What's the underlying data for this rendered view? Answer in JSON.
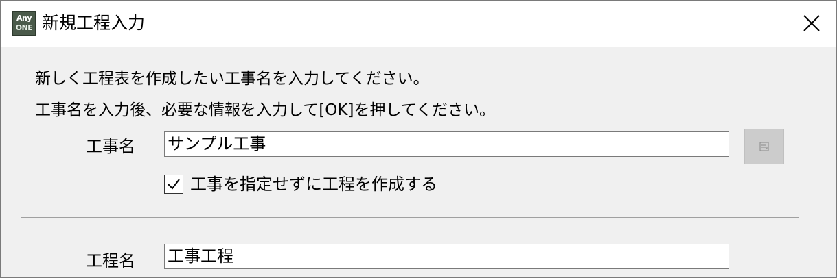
{
  "window": {
    "title": "新規工程入力",
    "app_icon": {
      "line1": "Any",
      "line2": "ONE"
    }
  },
  "instructions": {
    "line1": "新しく工程表を作成したい工事名を入力してください。",
    "line2": "工事名を入力後、必要な情報を入力して[OK]を押してください。"
  },
  "construction": {
    "label": "工事名",
    "value": "サンプル工事",
    "browse_icon": "select-list-icon"
  },
  "no_construction_checkbox": {
    "checked": true,
    "label": "工事を指定せずに工程を作成する"
  },
  "process": {
    "label": "工程名",
    "value": "工事工程"
  },
  "icons": {
    "close": "close-icon",
    "check": "check-icon"
  },
  "colors": {
    "titlebar": "#ffffff",
    "client_background": "#f0f0f0",
    "disabled_button": "#cccccc",
    "input_border": "#7a7a7a"
  }
}
